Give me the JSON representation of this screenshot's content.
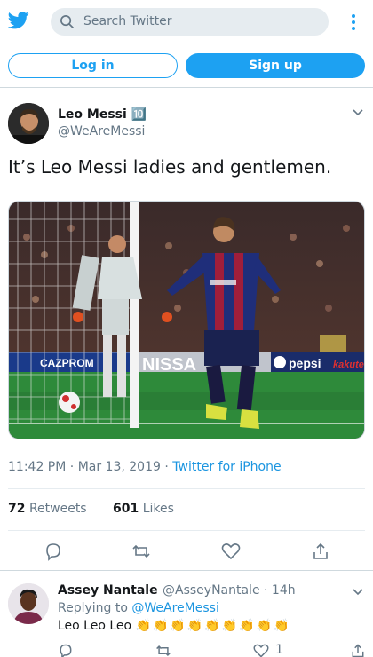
{
  "search": {
    "placeholder": "Search Twitter"
  },
  "auth": {
    "login": "Log in",
    "signup": "Sign up"
  },
  "tweet": {
    "author_name": "Leo Messi",
    "author_badge": "🔟",
    "author_handle": "@WeAreMessi",
    "text": "It’s Leo Messi ladies and gentlemen.",
    "time": "11:42 PM",
    "date": "Mar 13, 2019",
    "source": "Twitter for iPhone",
    "retweets_count": "72",
    "retweets_label": "Retweets",
    "likes_count": "601",
    "likes_label": "Likes",
    "media_banners": [
      "CAZPROM",
      "NISSA",
      "pepsi",
      "kakuten"
    ]
  },
  "reply": {
    "author_name": "Assey Nantale",
    "author_handle": "@AsseyNantale",
    "time": "14h",
    "replying_prefix": "Replying to",
    "replying_to": "@WeAreMessi",
    "text": "Leo Leo Leo",
    "claps": "👏👏👏👏👏👏👏👏👏",
    "likes": "1"
  },
  "colors": {
    "brand": "#1da1f2",
    "link": "#1b95e0",
    "muted": "#657786"
  }
}
